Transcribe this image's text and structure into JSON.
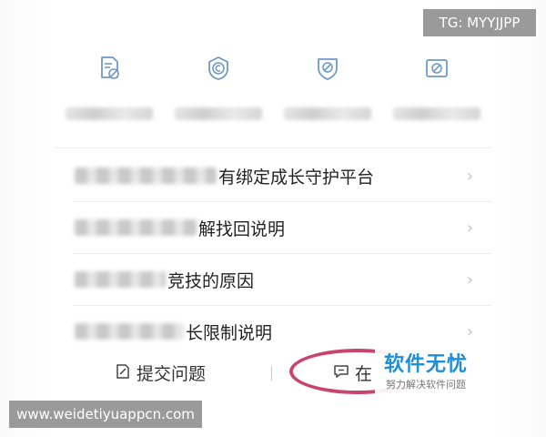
{
  "watermarks": {
    "top_right": "TG: MYYJJPP",
    "bottom_left": "www.weidetiyuappcn.com",
    "brand_title": "软件无忧",
    "brand_subtitle": "努力解决软件问题"
  },
  "icons": [
    {
      "icon": "document-block-icon"
    },
    {
      "icon": "coin-badge-icon"
    },
    {
      "icon": "shield-block-icon"
    },
    {
      "icon": "image-block-icon"
    }
  ],
  "list": {
    "items": [
      {
        "visible_text": "有绑定成长守护平台"
      },
      {
        "visible_text": "解找回说明"
      },
      {
        "visible_text": "竞技的原因"
      },
      {
        "visible_text": "长限制说明"
      }
    ]
  },
  "bottom_bar": {
    "submit_label": "提交问题",
    "online_label": "在"
  },
  "colors": {
    "icon_blue": "#6f9ac8",
    "highlight_ellipse": "#c8456e",
    "brand_blue": "#1f8fd8"
  }
}
